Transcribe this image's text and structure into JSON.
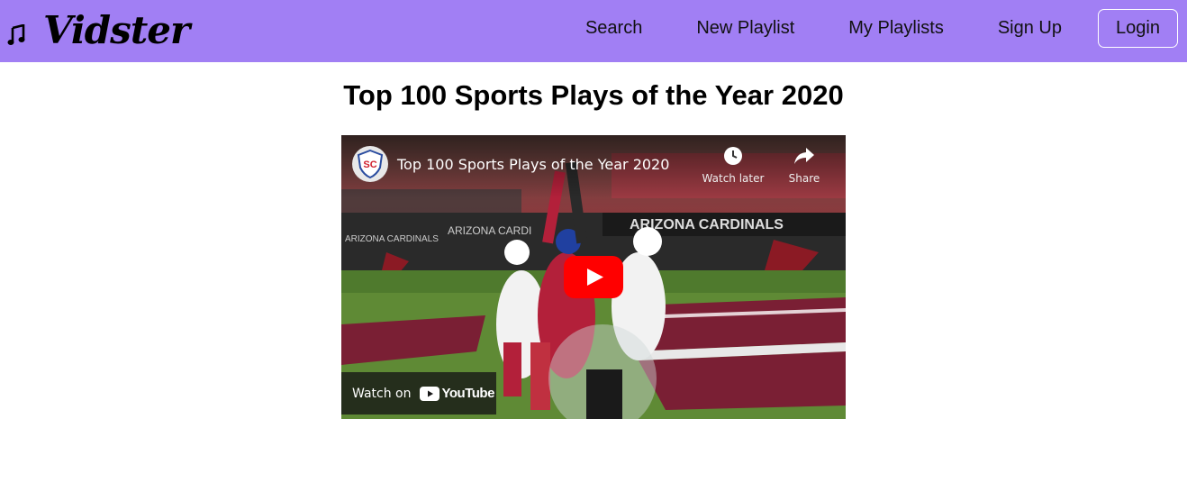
{
  "nav": {
    "brand": "Vidster",
    "brand_icon": "music-note-icon",
    "links": [
      "Search",
      "New Playlist",
      "My Playlists",
      "Sign Up"
    ],
    "login": "Login",
    "background_color": "#a17ff4"
  },
  "page": {
    "title": "Top 100 Sports Plays of the Year 2020"
  },
  "video": {
    "title": "Top 100 Sports Plays of the Year 2020",
    "channel_initials": "SC",
    "watch_later": "Watch later",
    "share": "Share",
    "watch_on": "Watch on",
    "platform": "YouTube",
    "banner_text": "ARIZONA CARDINALS",
    "wall_text_1": "ARIZONA CARDINALS",
    "wall_text_2": "ARIZONA CARDI",
    "icons": [
      "channel-avatar-icon",
      "clock-icon",
      "share-icon",
      "play-icon",
      "youtube-logo-icon"
    ]
  }
}
